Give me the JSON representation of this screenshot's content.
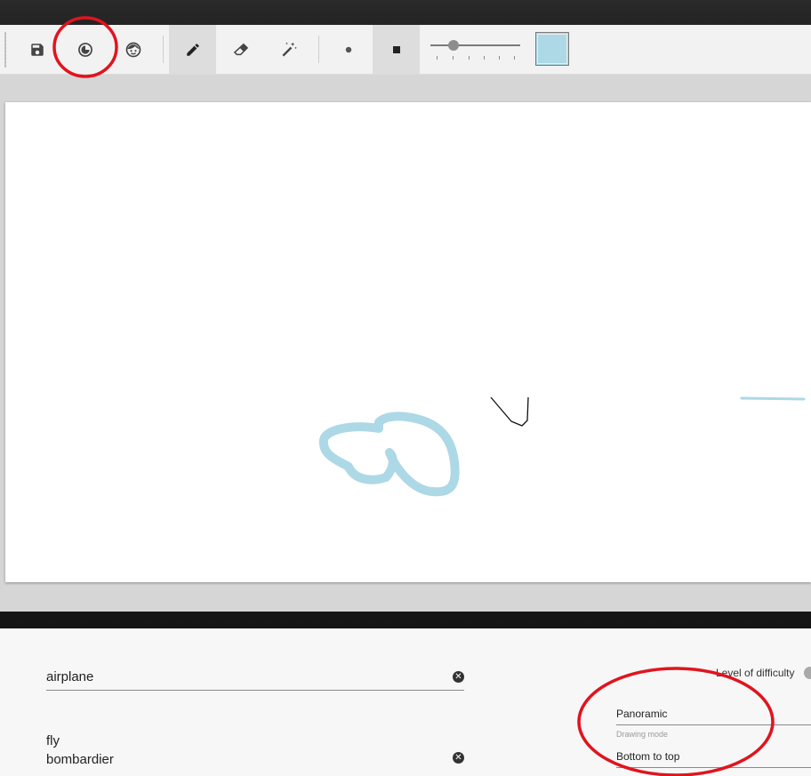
{
  "colors": {
    "brush_color": "#add8e6",
    "annotation_color": "#e0141e",
    "toolbar_bg": "#f2f2f2",
    "active_tool_bg": "#dddddd"
  },
  "toolbar": {
    "icons": [
      "save-icon",
      "history-icon",
      "face-icon",
      "pencil-icon",
      "eraser-icon",
      "magic-wand-icon",
      "round-brush-icon",
      "square-brush-icon"
    ],
    "active_tool": "pencil",
    "active_brush_shape": "square",
    "brush_size_level": 0.2
  },
  "form": {
    "label_input": {
      "value": "airplane"
    },
    "keywords_input": {
      "line1": "fly",
      "line2": "bombardier"
    },
    "difficulty_label": "Level of difficulty",
    "view_select": {
      "value": "Panoramic"
    },
    "drawing_mode": {
      "helper": "Drawing mode",
      "value": "Bottom to top"
    }
  }
}
